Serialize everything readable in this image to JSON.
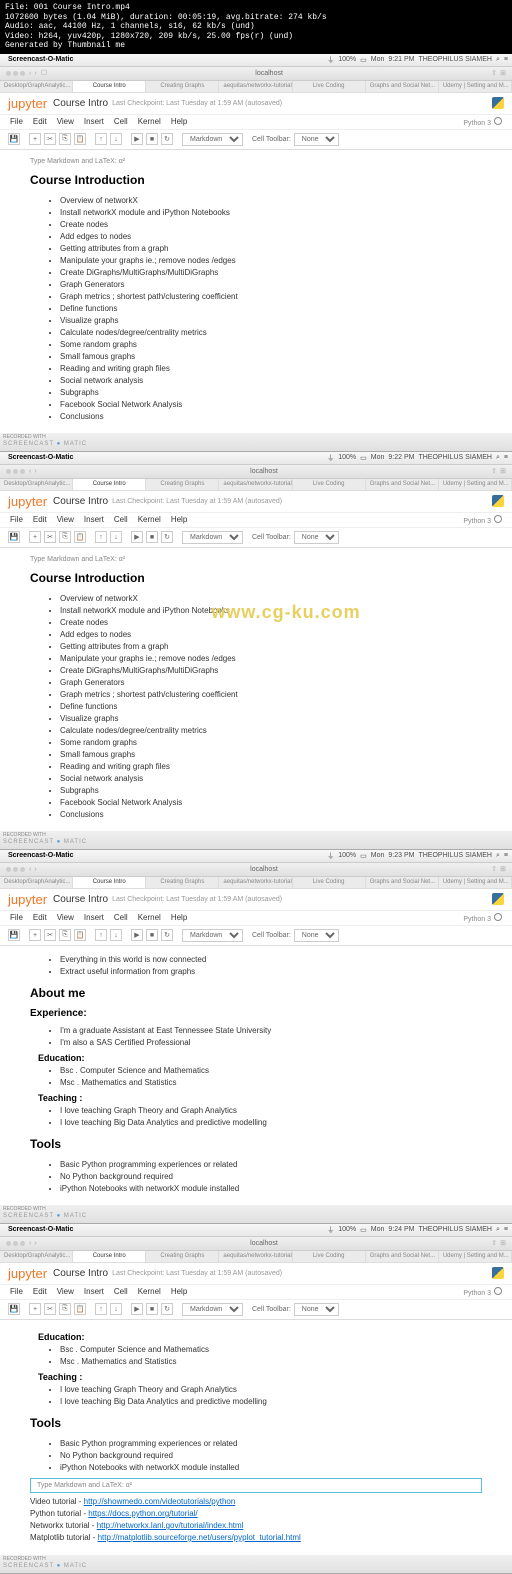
{
  "terminal": {
    "line1": "File: 001 Course Intro.mp4",
    "line2": "1072600 bytes (1.04 MiB), duration: 00:05:19, avg.bitrate: 274 kb/s",
    "line3": "Audio: aac, 44100 Hz, 1 channels, s16, 62 kb/s (und)",
    "line4": "Video: h264, yuv420p, 1280x720, 209 kb/s, 25.00 fps(r) (und)",
    "line5": "Generated by Thumbnail me"
  },
  "menubar": {
    "app": "Screencast-O-Matic",
    "battery": "100%",
    "day": "Mon",
    "user": "THEOPHILUS SIAMEH"
  },
  "times": [
    "9:21 PM",
    "9:22 PM",
    "9:23 PM",
    "9:24 PM"
  ],
  "browser": {
    "url": "localhost"
  },
  "tabs": {
    "t1": "Desktop/GraphAnalytic...",
    "t2": "Course Intro",
    "t3": "Creating Graphs",
    "t4": "aequitas/networkx-tutorial",
    "t5": "Live Coding",
    "t6": "Graphs and Social Net...",
    "t7": "Udemy | Setting and M..."
  },
  "jupyter": {
    "logo": "jupyter",
    "title": "Course Intro",
    "checkpoint": "Last Checkpoint: Last Tuesday at 1:59 AM (autosaved)",
    "menus": [
      "File",
      "Edit",
      "View",
      "Insert",
      "Cell",
      "Kernel",
      "Help"
    ],
    "kernel": "Python 3",
    "celltype": "Markdown",
    "celltoolbar_label": "Cell Toolbar:",
    "celltoolbar_value": "None",
    "prompt": "Type Markdown and LaTeX: α²"
  },
  "course": {
    "heading": "Course Introduction",
    "items": [
      "Overview of networkX",
      "Install networkX module and iPython Notebooks",
      "Create nodes",
      "Add edges to nodes",
      "Getting attributes from a graph",
      "Manipulate your graphs ie.; remove nodes /edges",
      "Create DiGraphs/MultiGraphs/MultiDiGraphs",
      "Graph Generators",
      "Graph metrics ; shortest path/clustering coefficient",
      "Define functions",
      "Visualize graphs",
      "Calculate nodes/degree/centrality metrics",
      "Some random graphs",
      "Small famous graphs",
      "Reading and writing graph files",
      "Social network analysis",
      "Subgraphs",
      "Facebook Social Network Analysis",
      "Conclusions"
    ]
  },
  "about": {
    "pre_items": [
      "Everything in this world is now connected",
      "Extract useful information from graphs"
    ],
    "heading": "About me",
    "exp_heading": "Experience:",
    "exp_items": [
      "I'm a graduate Assistant at East Tennessee State University",
      "I'm also a SAS Certified Professional"
    ],
    "edu_heading": "Education:",
    "edu_items": [
      "Bsc . Computer Science and Mathematics",
      "Msc . Mathematics and Statistics"
    ],
    "teach_heading": "Teaching :",
    "teach_items": [
      "I love teaching Graph Theory and Graph Analytics",
      "I love teaching Big Data Analytics and predictive modelling"
    ],
    "tools_heading": "Tools",
    "tools_items": [
      "Basic Python programming experiences or related",
      "No Python background required",
      "iPython Notebooks with networkX module installed"
    ]
  },
  "links": {
    "video_label": "Video tutorial - ",
    "video_url": "http://showmedo.com/videotutorials/python",
    "python_label": "Python tutorial - ",
    "python_url": "https://docs.python.org/tutorial/",
    "nx_label": "Networkx tutorial - ",
    "nx_url": "http://networkx.lanl.gov/tutorial/index.html",
    "mpl_label": "Matplotlib tutorial - ",
    "mpl_url": "http://matplotlib.sourceforge.net/users/pyplot_tutorial.html"
  },
  "watermark": {
    "rec": "RECORDED WITH",
    "som": "SCREENCAST",
    "matic": "MATIC",
    "center": "www.cg-ku.com"
  }
}
